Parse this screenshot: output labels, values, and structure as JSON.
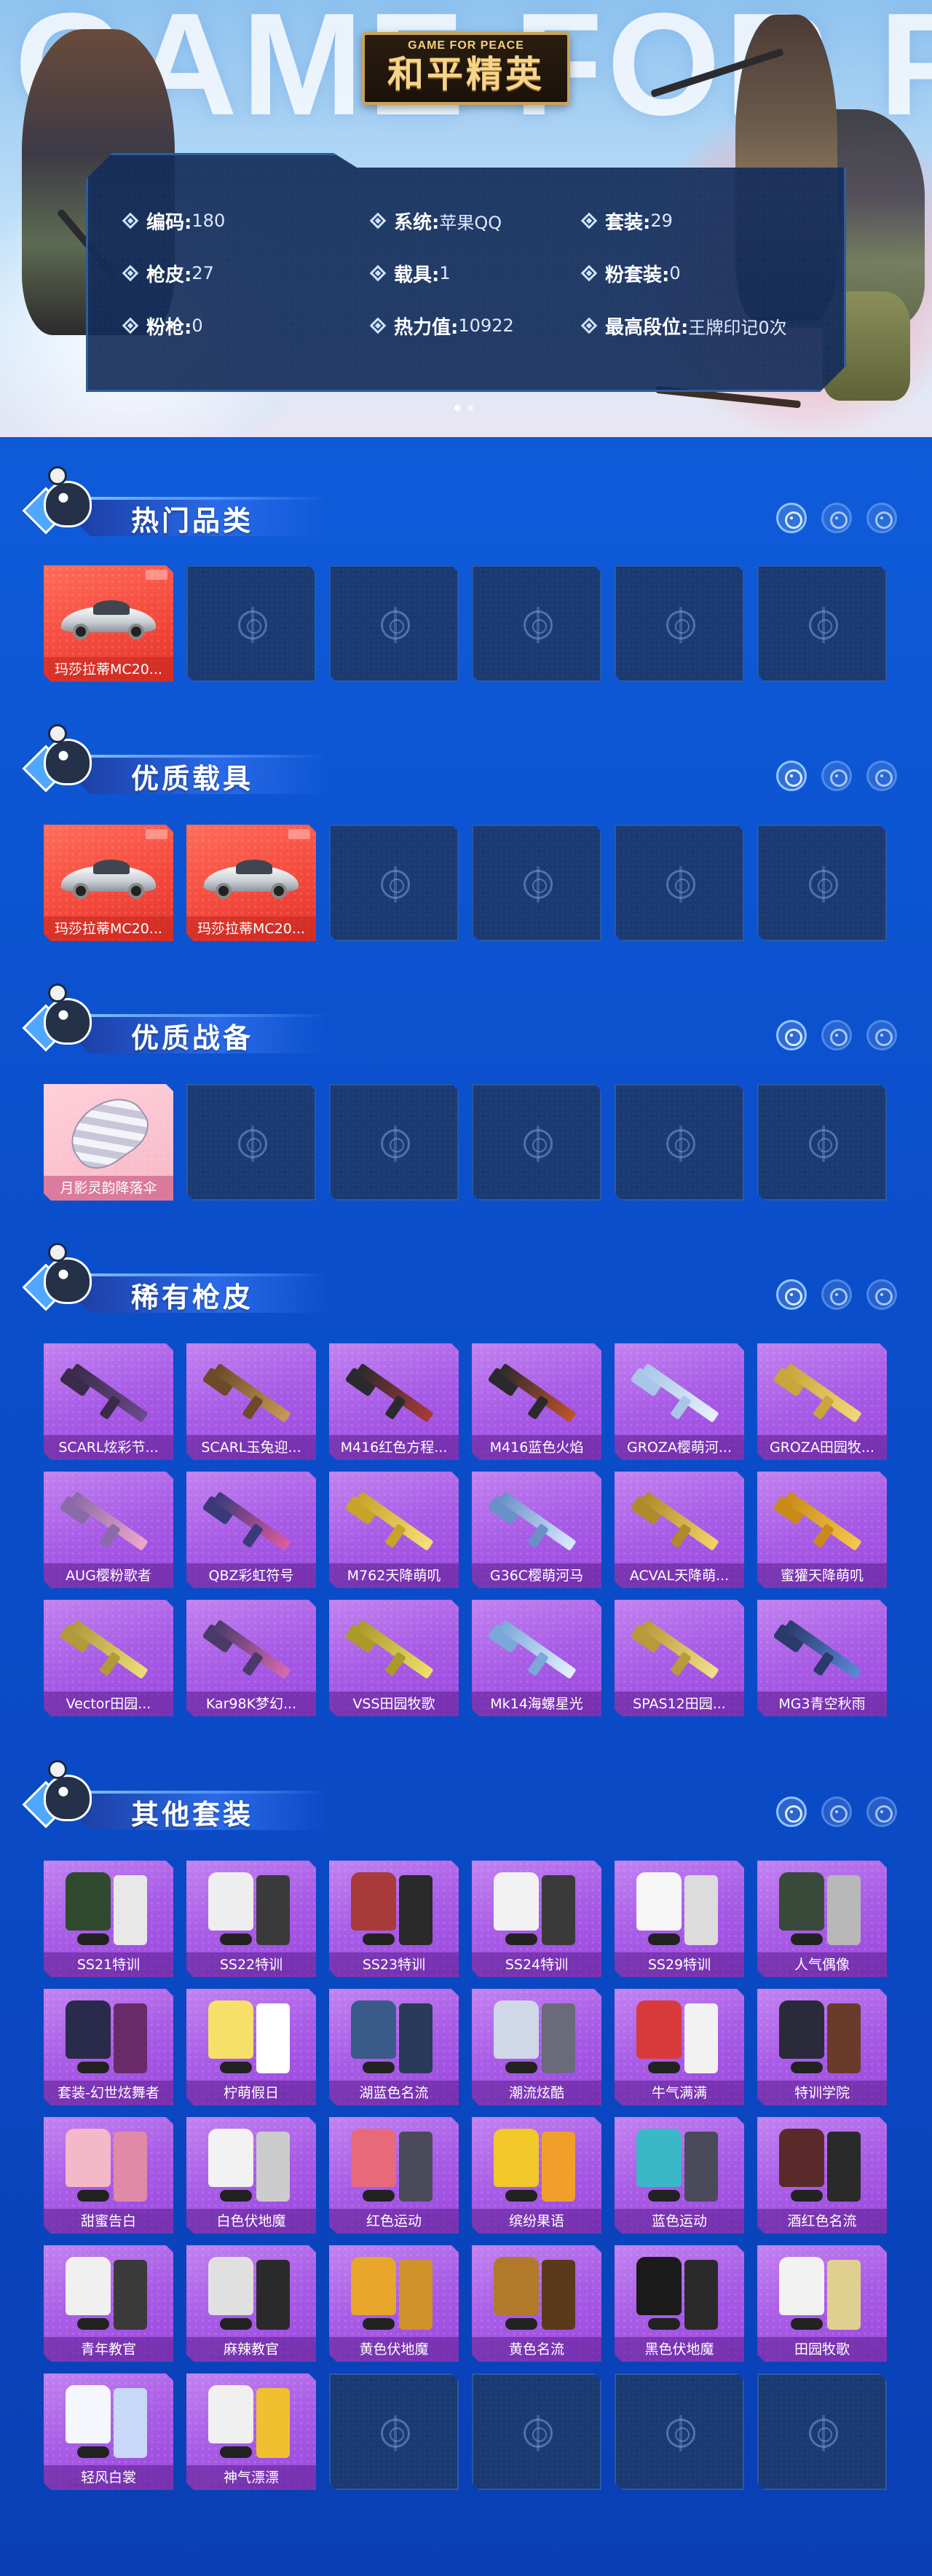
{
  "hero": {
    "bg_text": "GAME FOR PEACE",
    "logo_en": "GAME FOR PEACE",
    "logo_cn": "和平精英"
  },
  "info": {
    "rows": [
      [
        {
          "label": "编码:",
          "value": "180"
        },
        {
          "label": "系统:",
          "value": "苹果QQ"
        },
        {
          "label": "套装:",
          "value": "29"
        }
      ],
      [
        {
          "label": "枪皮:",
          "value": "27"
        },
        {
          "label": "载具:",
          "value": "1"
        },
        {
          "label": "粉套装:",
          "value": "0"
        }
      ],
      [
        {
          "label": "粉枪:",
          "value": "0"
        },
        {
          "label": "热力值:",
          "value": "10922"
        },
        {
          "label": "最高段位:",
          "value": "王牌印记0次"
        }
      ]
    ]
  },
  "sections": [
    {
      "title": "热门品类",
      "items": [
        {
          "caption": "玛莎拉蒂MC20...",
          "style": "red",
          "art": "car"
        },
        {
          "empty": true
        },
        {
          "empty": true
        },
        {
          "empty": true
        },
        {
          "empty": true
        },
        {
          "empty": true
        }
      ]
    },
    {
      "title": "优质载具",
      "items": [
        {
          "caption": "玛莎拉蒂MC20...",
          "style": "red",
          "art": "car"
        },
        {
          "caption": "玛莎拉蒂MC20...",
          "style": "red",
          "art": "car"
        },
        {
          "empty": true
        },
        {
          "empty": true
        },
        {
          "empty": true
        },
        {
          "empty": true
        }
      ]
    },
    {
      "title": "优质战备",
      "items": [
        {
          "caption": "月影灵韵降落伞",
          "style": "pink",
          "art": "para"
        },
        {
          "empty": true
        },
        {
          "empty": true
        },
        {
          "empty": true
        },
        {
          "empty": true
        },
        {
          "empty": true
        }
      ]
    },
    {
      "title": "稀有枪皮",
      "items": [
        {
          "caption": "SCARL炫彩节...",
          "style": "purple",
          "art": "gun",
          "c1": "#3b2a4a",
          "c2": "#6a4b8c"
        },
        {
          "caption": "SCARL玉兔迎...",
          "style": "purple",
          "art": "gun",
          "c1": "#6b4a2a",
          "c2": "#c99a55"
        },
        {
          "caption": "M416红色方程...",
          "style": "purple",
          "art": "gun",
          "c1": "#2a2a2e",
          "c2": "#a83a3a"
        },
        {
          "caption": "M416蓝色火焰",
          "style": "purple",
          "art": "gun",
          "c1": "#2a2a2e",
          "c2": "#c0532a"
        },
        {
          "caption": "GROZA樱萌河...",
          "style": "purple",
          "art": "gun",
          "c1": "#a9c6e8",
          "c2": "#e8f1fb"
        },
        {
          "caption": "GROZA田园牧...",
          "style": "purple",
          "art": "gun",
          "c1": "#c9a53a",
          "c2": "#f1d878"
        },
        {
          "caption": "AUG樱粉歌者",
          "style": "purple",
          "art": "gun",
          "c1": "#8a6aa8",
          "c2": "#f0a8c8"
        },
        {
          "caption": "QBZ彩虹符号",
          "style": "purple",
          "art": "gun",
          "c1": "#3a3a7a",
          "c2": "#e05aa0"
        },
        {
          "caption": "M762天降萌叽",
          "style": "purple",
          "art": "gun",
          "c1": "#c9a22a",
          "c2": "#f6e07a"
        },
        {
          "caption": "G36C樱萌河马",
          "style": "purple",
          "art": "gun",
          "c1": "#6a90c8",
          "c2": "#dbeaff"
        },
        {
          "caption": "ACVAL天降萌...",
          "style": "purple",
          "art": "gun",
          "c1": "#b08a2a",
          "c2": "#f2d46a"
        },
        {
          "caption": "蜜獾天降萌叽",
          "style": "purple",
          "art": "gun",
          "c1": "#c98a1a",
          "c2": "#f6c84a"
        },
        {
          "caption": "Vector田园...",
          "style": "purple",
          "art": "gun",
          "c1": "#b09a3a",
          "c2": "#eedc7a"
        },
        {
          "caption": "Kar98K梦幻...",
          "style": "purple",
          "art": "gun",
          "c1": "#4a3a6a",
          "c2": "#d86ab0"
        },
        {
          "caption": "VSS田园牧歌",
          "style": "purple",
          "art": "gun",
          "c1": "#a99a2a",
          "c2": "#f0e06a"
        },
        {
          "caption": "Mk14海螺星光",
          "style": "purple",
          "art": "gun",
          "c1": "#7aa8d8",
          "c2": "#e6f2ff"
        },
        {
          "caption": "SPAS12田园...",
          "style": "purple",
          "art": "gun",
          "c1": "#b89a3a",
          "c2": "#f2e08a"
        },
        {
          "caption": "MG3青空秋雨",
          "style": "purple",
          "art": "gun",
          "c1": "#2a3a6a",
          "c2": "#5a88d8"
        }
      ]
    },
    {
      "title": "其他套装",
      "items": [
        {
          "caption": "SS21特训",
          "style": "purple",
          "art": "outfit",
          "c1": "#2f4a2f",
          "c2": "#e8e8e8"
        },
        {
          "caption": "SS22特训",
          "style": "purple",
          "art": "outfit",
          "c1": "#eeeeee",
          "c2": "#3a3a3a"
        },
        {
          "caption": "SS23特训",
          "style": "purple",
          "art": "outfit",
          "c1": "#a83a3a",
          "c2": "#2a2a2a"
        },
        {
          "caption": "SS24特训",
          "style": "purple",
          "art": "outfit",
          "c1": "#f2f2f2",
          "c2": "#3a3a3a"
        },
        {
          "caption": "SS29特训",
          "style": "purple",
          "art": "outfit",
          "c1": "#f6f6f6",
          "c2": "#dcdcdc"
        },
        {
          "caption": "人气偶像",
          "style": "purple",
          "art": "outfit",
          "c1": "#3a4a3a",
          "c2": "#b8b8b8"
        },
        {
          "caption": "套装-幻世炫舞者",
          "style": "purple",
          "art": "outfit",
          "c1": "#2a2a4a",
          "c2": "#6a2a6a"
        },
        {
          "caption": "柠萌假日",
          "style": "purple",
          "art": "outfit",
          "c1": "#f6e06a",
          "c2": "#ffffff"
        },
        {
          "caption": "湖蓝色名流",
          "style": "purple",
          "art": "outfit",
          "c1": "#3a5a8a",
          "c2": "#2a3a5a"
        },
        {
          "caption": "潮流炫酷",
          "style": "purple",
          "art": "outfit",
          "c1": "#d0d8e8",
          "c2": "#6a6a7a"
        },
        {
          "caption": "牛气满满",
          "style": "purple",
          "art": "outfit",
          "c1": "#d83a3a",
          "c2": "#f2f2f2"
        },
        {
          "caption": "特训学院",
          "style": "purple",
          "art": "outfit",
          "c1": "#2a2a3a",
          "c2": "#6a3a2a"
        },
        {
          "caption": "甜蜜告白",
          "style": "purple",
          "art": "outfit",
          "c1": "#f4b8c8",
          "c2": "#e08aa8"
        },
        {
          "caption": "白色伏地魔",
          "style": "purple",
          "art": "outfit",
          "c1": "#f2f2f2",
          "c2": "#cccccc"
        },
        {
          "caption": "红色运动",
          "style": "purple",
          "art": "outfit",
          "c1": "#e86a7a",
          "c2": "#4a4a5a"
        },
        {
          "caption": "缤纷果语",
          "style": "purple",
          "art": "outfit",
          "c1": "#f2c82a",
          "c2": "#f0a02a"
        },
        {
          "caption": "蓝色运动",
          "style": "purple",
          "art": "outfit",
          "c1": "#3ab8c8",
          "c2": "#4a4a5a"
        },
        {
          "caption": "酒红色名流",
          "style": "purple",
          "art": "outfit",
          "c1": "#5a2a2a",
          "c2": "#2a2a2a"
        },
        {
          "caption": "青年教官",
          "style": "purple",
          "art": "outfit",
          "c1": "#f0f0f0",
          "c2": "#3a3a3a"
        },
        {
          "caption": "麻辣教官",
          "style": "purple",
          "art": "outfit",
          "c1": "#e0e0e0",
          "c2": "#2a2a2a"
        },
        {
          "caption": "黄色伏地魔",
          "style": "purple",
          "art": "outfit",
          "c1": "#e8a62a",
          "c2": "#d0922a"
        },
        {
          "caption": "黄色名流",
          "style": "purple",
          "art": "outfit",
          "c1": "#b07a2a",
          "c2": "#5a3a1a"
        },
        {
          "caption": "黑色伏地魔",
          "style": "purple",
          "art": "outfit",
          "c1": "#1a1a1a",
          "c2": "#2a2a2a"
        },
        {
          "caption": "田园牧歌",
          "style": "purple",
          "art": "outfit",
          "c1": "#f2f2f2",
          "c2": "#e0d090"
        },
        {
          "caption": "轻风白裳",
          "style": "purple",
          "art": "outfit",
          "c1": "#f6f6ff",
          "c2": "#c8d8f8"
        },
        {
          "caption": "神气漂漂",
          "style": "purple",
          "art": "outfit",
          "c1": "#f0f0f0",
          "c2": "#f0c030"
        },
        {
          "empty": true
        },
        {
          "empty": true
        },
        {
          "empty": true
        },
        {
          "empty": true
        }
      ]
    }
  ],
  "colors": {
    "page_bg": "#0a55d2",
    "panel_bg": "#142d5a",
    "tile_empty": "#1c3a72",
    "tile_purple": "#a85ce6",
    "tile_red": "#f44a3e",
    "tile_pink": "#f6b7c6"
  },
  "icons": [
    "shield-icon",
    "crosshair-icon",
    "target-icon",
    "penguin-mascot-icon"
  ]
}
